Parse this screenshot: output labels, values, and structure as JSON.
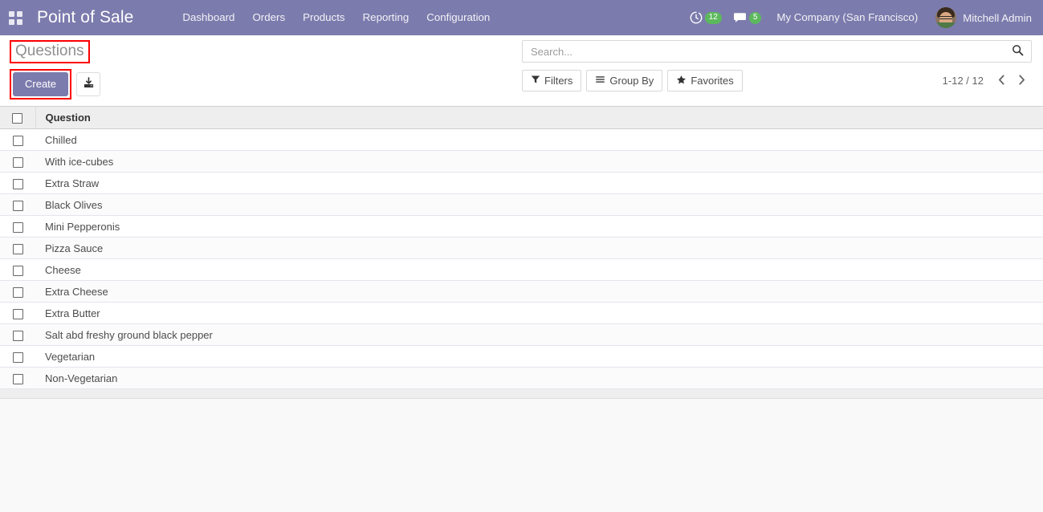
{
  "navbar": {
    "apps_icon": "grid-apps-icon",
    "brand": "Point of Sale",
    "menu_items": [
      {
        "label": "Dashboard"
      },
      {
        "label": "Orders"
      },
      {
        "label": "Products"
      },
      {
        "label": "Reporting"
      },
      {
        "label": "Configuration"
      }
    ],
    "systray": {
      "activity_icon": "clock-activity-icon",
      "activity_count": "12",
      "messaging_icon": "chat-bubble-icon",
      "messaging_count": "5",
      "company": "My Company (San Francisco)",
      "avatar_icon": "user-avatar",
      "user_name": "Mitchell Admin"
    },
    "colors": {
      "background": "#7c7bad",
      "text": "#f2f2f7",
      "badge": "#5cb85c"
    }
  },
  "control_panel": {
    "breadcrumb_title": "Questions",
    "create_label": "Create",
    "import_icon": "download-import-icon",
    "highlight_color": "#fe0000",
    "search": {
      "placeholder": "Search...",
      "value": "",
      "search_icon": "search-icon"
    },
    "filter_buttons": [
      {
        "label": "Filters",
        "icon": "filter-funnel-icon"
      },
      {
        "label": "Group By",
        "icon": "hamburger-lines-icon"
      },
      {
        "label": "Favorites",
        "icon": "star-icon"
      }
    ],
    "pager": {
      "value": "1-12 / 12",
      "previous_icon": "chevron-left-icon",
      "next_icon": "chevron-right-icon"
    }
  },
  "list_view": {
    "columns": [
      "Question"
    ],
    "rows": [
      {
        "question": "Chilled"
      },
      {
        "question": "With ice-cubes"
      },
      {
        "question": "Extra Straw"
      },
      {
        "question": "Black Olives"
      },
      {
        "question": "Mini Pepperonis"
      },
      {
        "question": "Pizza Sauce"
      },
      {
        "question": "Cheese"
      },
      {
        "question": "Extra Cheese"
      },
      {
        "question": "Extra Butter"
      },
      {
        "question": "Salt abd freshy ground black pepper"
      },
      {
        "question": "Vegetarian"
      },
      {
        "question": "Non-Vegetarian"
      }
    ]
  }
}
